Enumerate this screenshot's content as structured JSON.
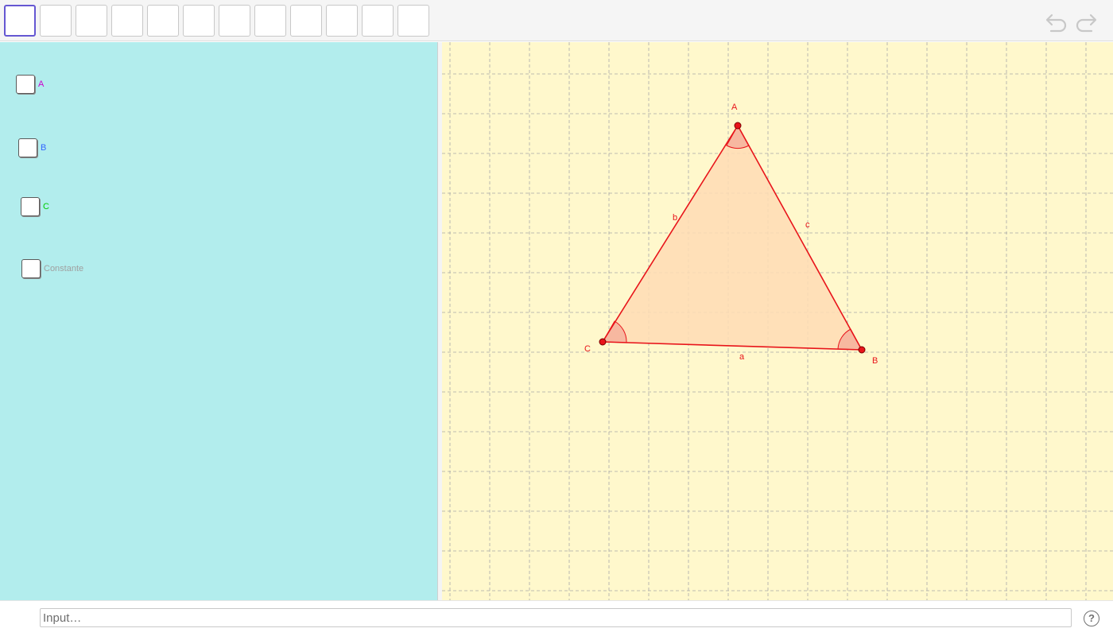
{
  "toolbar": {
    "tools": [
      "move-tool",
      "point-tool",
      "line-tool",
      "perpendicular-tool",
      "polygon-tool",
      "circle-tool",
      "conic-tool",
      "angle-tool",
      "reflect-tool",
      "slider-tool",
      "text-tool",
      "view-tool"
    ],
    "undo_icon": "undo-arrow-icon",
    "redo_icon": "redo-arrow-icon",
    "active_color": "#6557d2"
  },
  "checkboxes": [
    {
      "label": "A",
      "color": "#cc00cc",
      "checked": false
    },
    {
      "label": "B",
      "color": "#3366ff",
      "checked": false
    },
    {
      "label": "C",
      "color": "#00cc00",
      "checked": false
    },
    {
      "label": "Constante",
      "color": "#a0a0a0",
      "checked": false
    }
  ],
  "graphics": {
    "background": "#fff8cc",
    "grid": "dashed",
    "triangle": {
      "stroke": "#e8141a",
      "fill": "#ffdcb4",
      "vertices": [
        "A",
        "B",
        "C"
      ],
      "sides": [
        "a",
        "b",
        "c"
      ]
    }
  },
  "input_bar": {
    "placeholder": "Input…",
    "help_label": "?"
  },
  "colors": {
    "panel": "#b2eded",
    "toolbar": "#f5f5f5"
  }
}
